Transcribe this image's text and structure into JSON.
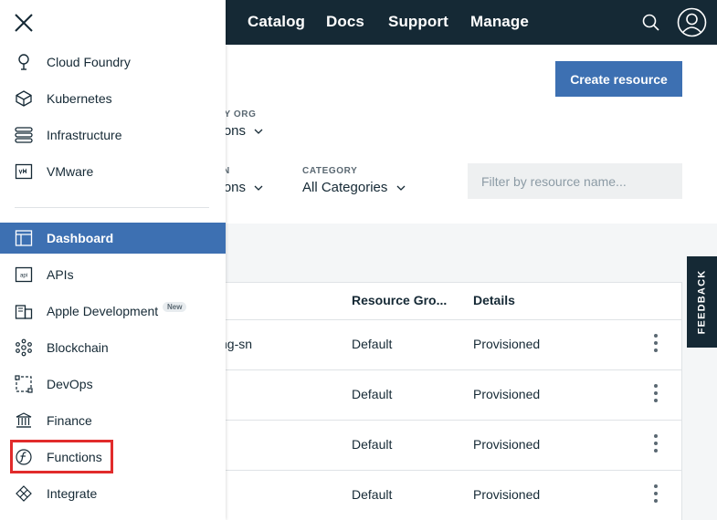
{
  "header": {
    "nav": [
      "Catalog",
      "Docs",
      "Support",
      "Manage"
    ],
    "icons": {
      "search": "search-icon",
      "avatar": "user-avatar-icon"
    },
    "bg_color": "#152935"
  },
  "side_panel": {
    "close_icon": "close-icon",
    "compute_items": [
      {
        "label": "Cloud Foundry",
        "icon": "cloud-foundry-icon"
      },
      {
        "label": "Kubernetes",
        "icon": "kubernetes-icon"
      },
      {
        "label": "Infrastructure",
        "icon": "infrastructure-icon"
      },
      {
        "label": "VMware",
        "icon": "vmware-icon"
      }
    ],
    "nav_items": [
      {
        "label": "Dashboard",
        "icon": "dashboard-icon",
        "active": true
      },
      {
        "label": "APIs",
        "icon": "api-icon"
      },
      {
        "label": "Apple Development",
        "icon": "apple-development-icon",
        "badge": "New"
      },
      {
        "label": "Blockchain",
        "icon": "blockchain-icon"
      },
      {
        "label": "DevOps",
        "icon": "devops-icon"
      },
      {
        "label": "Finance",
        "icon": "finance-icon"
      },
      {
        "label": "Functions",
        "icon": "functions-icon",
        "highlighted": true
      },
      {
        "label": "Integrate",
        "icon": "integrate-icon"
      }
    ],
    "active_color": "#3d70b2",
    "highlight_color": "#e12b2b"
  },
  "main": {
    "create_button": "Create resource",
    "filters": {
      "org_label": "RY ORG",
      "org_value": "ations",
      "group_label": "N",
      "group_value": "ations",
      "category_label": "CATEGORY",
      "category_value": "All Categories",
      "search_placeholder": "Filter by resource name..."
    },
    "table": {
      "headers": [
        "Resource Gro...",
        "Details"
      ],
      "rows": [
        {
          "name": "ng-sn",
          "group": "Default",
          "details": "Provisioned"
        },
        {
          "name": "",
          "group": "Default",
          "details": "Provisioned"
        },
        {
          "name": "",
          "group": "Default",
          "details": "Provisioned"
        },
        {
          "name": "",
          "group": "Default",
          "details": "Provisioned"
        }
      ]
    },
    "feedback_tab": "FEEDBACK"
  }
}
